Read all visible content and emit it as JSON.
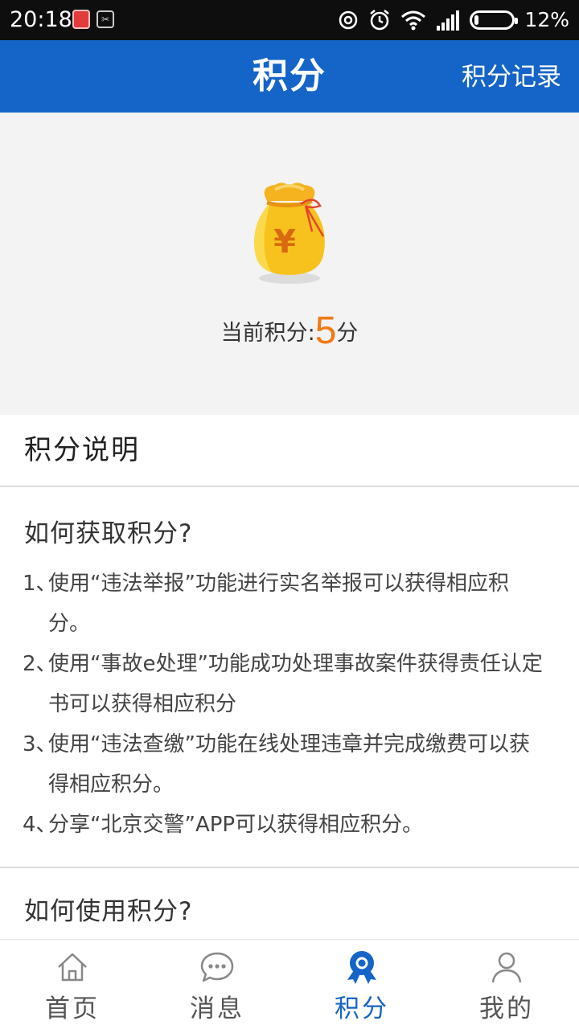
{
  "status_bar": {
    "time": "20:18",
    "battery_percent": "12%",
    "battery_level": 0.12,
    "icons": [
      "notification-app-icon",
      "screenshot-app-icon",
      "sync-icon",
      "alarm-icon",
      "wifi-icon",
      "signal-icon",
      "battery-icon"
    ]
  },
  "header": {
    "title": "积分",
    "right_action": "积分记录"
  },
  "points": {
    "label": "当前积分:",
    "value": "5",
    "unit": "分",
    "icon": "money-bag-icon",
    "bag_symbol": "¥"
  },
  "section": {
    "title": "积分说明"
  },
  "earn": {
    "title": "如何获取积分?",
    "items": [
      {
        "no": "1、",
        "text": "使用“违法举报”功能进行实名举报可以获得相应积分。"
      },
      {
        "no": "2、",
        "text": "使用“事故e处理”功能成功处理事故案件获得责任认定书可以获得相应积分"
      },
      {
        "no": "3、",
        "text": "使用“违法查缴”功能在线处理违章并完成缴费可以获得相应积分。"
      },
      {
        "no": "4、",
        "text": "分享“北京交警”APP可以获得相应积分。"
      }
    ]
  },
  "use": {
    "title": "如何使用积分?"
  },
  "tabbar": {
    "active_color": "#1565c8",
    "items": [
      {
        "label": "首页",
        "icon": "home-icon"
      },
      {
        "label": "消息",
        "icon": "chat-icon"
      },
      {
        "label": "积分",
        "icon": "award-badge-icon",
        "active": true
      },
      {
        "label": "我的",
        "icon": "person-icon"
      }
    ]
  },
  "colors": {
    "header_bg": "#1565c8",
    "accent_orange": "#f07a14",
    "card_bg": "#f3f3f3"
  }
}
